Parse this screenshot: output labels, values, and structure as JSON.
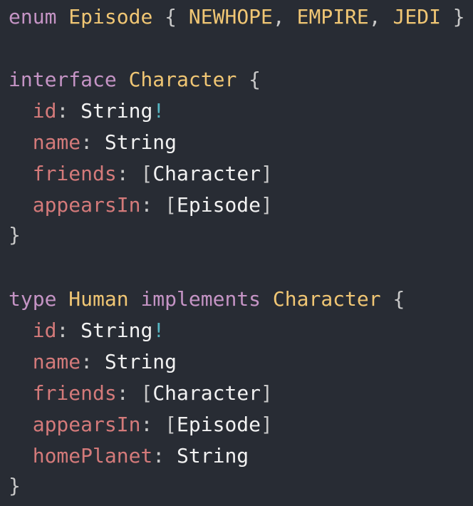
{
  "code": {
    "lines": [
      {
        "tokens": [
          {
            "text": "enum",
            "cls": "kw"
          },
          {
            "text": " "
          },
          {
            "text": "Episode",
            "cls": "tp"
          },
          {
            "text": " "
          },
          {
            "text": "{",
            "cls": "pn"
          },
          {
            "text": " "
          },
          {
            "text": "NEWHOPE",
            "cls": "tp"
          },
          {
            "text": ", ",
            "cls": "pn"
          },
          {
            "text": "EMPIRE",
            "cls": "tp"
          },
          {
            "text": ", ",
            "cls": "pn"
          },
          {
            "text": "JEDI",
            "cls": "tp"
          },
          {
            "text": " "
          },
          {
            "text": "}",
            "cls": "pn"
          }
        ]
      },
      {
        "tokens": []
      },
      {
        "tokens": [
          {
            "text": "interface",
            "cls": "kw"
          },
          {
            "text": " "
          },
          {
            "text": "Character",
            "cls": "tp"
          },
          {
            "text": " "
          },
          {
            "text": "{",
            "cls": "pn"
          }
        ]
      },
      {
        "tokens": [
          {
            "text": "  "
          },
          {
            "text": "id",
            "cls": "fd"
          },
          {
            "text": ": ",
            "cls": "pn"
          },
          {
            "text": "String",
            "cls": "tx"
          },
          {
            "text": "!",
            "cls": "bg"
          }
        ]
      },
      {
        "tokens": [
          {
            "text": "  "
          },
          {
            "text": "name",
            "cls": "fd"
          },
          {
            "text": ": ",
            "cls": "pn"
          },
          {
            "text": "String",
            "cls": "tx"
          }
        ]
      },
      {
        "tokens": [
          {
            "text": "  "
          },
          {
            "text": "friends",
            "cls": "fd"
          },
          {
            "text": ": ",
            "cls": "pn"
          },
          {
            "text": "[",
            "cls": "pn"
          },
          {
            "text": "Character",
            "cls": "tx"
          },
          {
            "text": "]",
            "cls": "pn"
          }
        ]
      },
      {
        "tokens": [
          {
            "text": "  "
          },
          {
            "text": "appearsIn",
            "cls": "fd"
          },
          {
            "text": ": ",
            "cls": "pn"
          },
          {
            "text": "[",
            "cls": "pn"
          },
          {
            "text": "Episode",
            "cls": "tx"
          },
          {
            "text": "]",
            "cls": "pn"
          }
        ]
      },
      {
        "tokens": [
          {
            "text": "}",
            "cls": "pn"
          }
        ]
      },
      {
        "tokens": []
      },
      {
        "tokens": [
          {
            "text": "type",
            "cls": "kw"
          },
          {
            "text": " "
          },
          {
            "text": "Human",
            "cls": "tp"
          },
          {
            "text": " "
          },
          {
            "text": "implements",
            "cls": "kw"
          },
          {
            "text": " "
          },
          {
            "text": "Character",
            "cls": "tp"
          },
          {
            "text": " "
          },
          {
            "text": "{",
            "cls": "pn"
          }
        ]
      },
      {
        "tokens": [
          {
            "text": "  "
          },
          {
            "text": "id",
            "cls": "fd"
          },
          {
            "text": ": ",
            "cls": "pn"
          },
          {
            "text": "String",
            "cls": "tx"
          },
          {
            "text": "!",
            "cls": "bg"
          }
        ]
      },
      {
        "tokens": [
          {
            "text": "  "
          },
          {
            "text": "name",
            "cls": "fd"
          },
          {
            "text": ": ",
            "cls": "pn"
          },
          {
            "text": "String",
            "cls": "tx"
          }
        ]
      },
      {
        "tokens": [
          {
            "text": "  "
          },
          {
            "text": "friends",
            "cls": "fd"
          },
          {
            "text": ": ",
            "cls": "pn"
          },
          {
            "text": "[",
            "cls": "pn"
          },
          {
            "text": "Character",
            "cls": "tx"
          },
          {
            "text": "]",
            "cls": "pn"
          }
        ]
      },
      {
        "tokens": [
          {
            "text": "  "
          },
          {
            "text": "appearsIn",
            "cls": "fd"
          },
          {
            "text": ": ",
            "cls": "pn"
          },
          {
            "text": "[",
            "cls": "pn"
          },
          {
            "text": "Episode",
            "cls": "tx"
          },
          {
            "text": "]",
            "cls": "pn"
          }
        ]
      },
      {
        "tokens": [
          {
            "text": "  "
          },
          {
            "text": "homePlanet",
            "cls": "fd"
          },
          {
            "text": ": ",
            "cls": "pn"
          },
          {
            "text": "String",
            "cls": "tx"
          }
        ]
      },
      {
        "tokens": [
          {
            "text": "}",
            "cls": "pn"
          }
        ]
      }
    ]
  },
  "colors": {
    "background": "#282c34",
    "keyword": "#c594c5",
    "type": "#f0c674",
    "field": "#d47a7a",
    "punctuation": "#c8c8c8",
    "bang": "#56b6c2",
    "text": "#f2f2f2"
  }
}
